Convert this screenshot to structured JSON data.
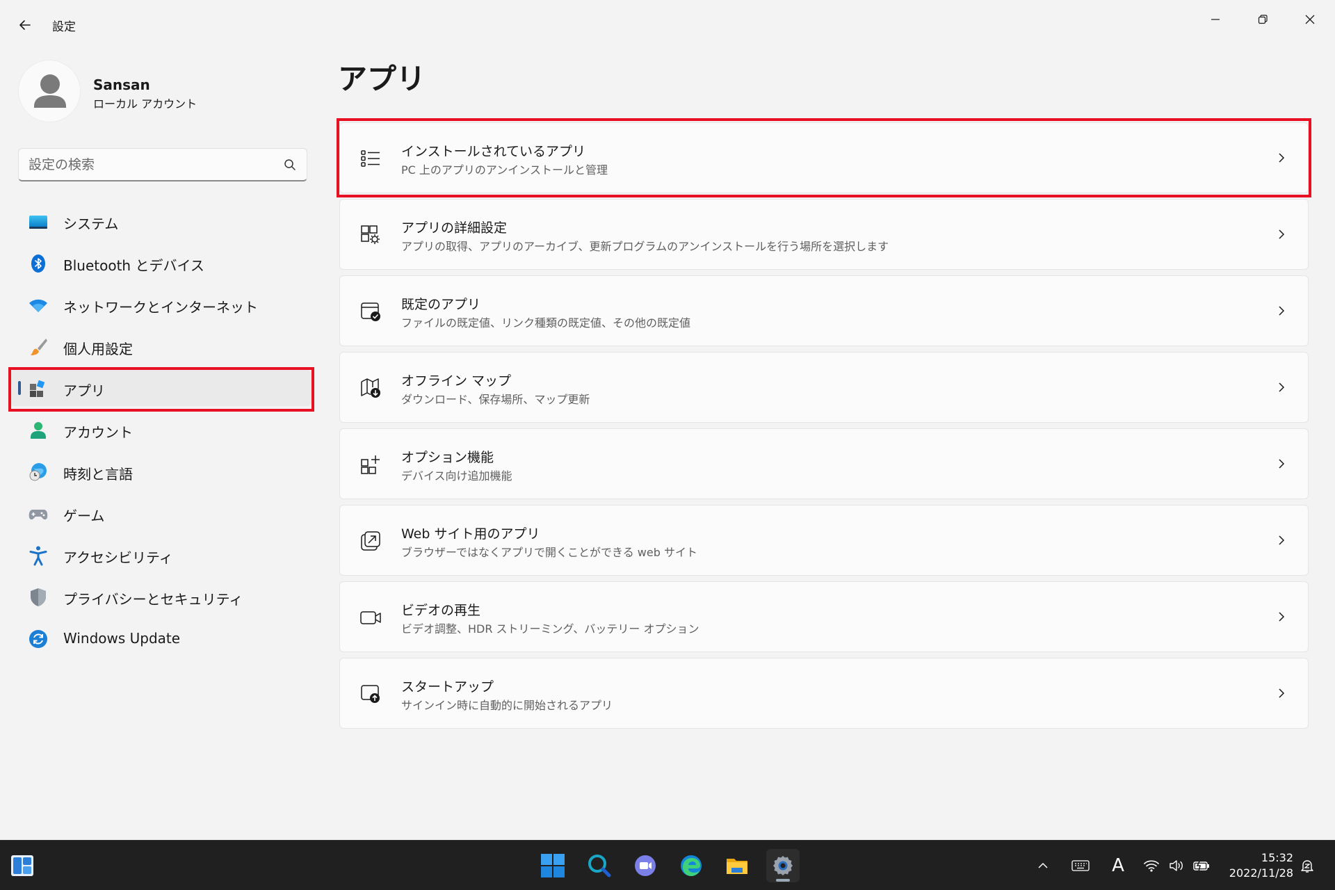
{
  "window": {
    "title": "設定",
    "controls": {
      "minimize": "minimize-icon",
      "maximize": "restore-icon",
      "close": "close-icon"
    }
  },
  "profile": {
    "name": "Sansan",
    "account_type": "ローカル アカウント"
  },
  "search": {
    "placeholder": "設定の検索",
    "value": ""
  },
  "sidebar": {
    "items": [
      {
        "label": "システム",
        "icon": "system-icon"
      },
      {
        "label": "Bluetooth とデバイス",
        "icon": "bluetooth-icon"
      },
      {
        "label": "ネットワークとインターネット",
        "icon": "wifi-icon"
      },
      {
        "label": "個人用設定",
        "icon": "brush-icon"
      },
      {
        "label": "アプリ",
        "icon": "apps-icon",
        "selected": true
      },
      {
        "label": "アカウント",
        "icon": "account-icon"
      },
      {
        "label": "時刻と言語",
        "icon": "time-language-icon"
      },
      {
        "label": "ゲーム",
        "icon": "gamepad-icon"
      },
      {
        "label": "アクセシビリティ",
        "icon": "accessibility-icon"
      },
      {
        "label": "プライバシーとセキュリティ",
        "icon": "shield-icon"
      },
      {
        "label": "Windows Update",
        "icon": "update-icon"
      }
    ]
  },
  "main": {
    "title": "アプリ",
    "cards": [
      {
        "title": "インストールされているアプリ",
        "desc": "PC 上のアプリのアンインストールと管理",
        "icon": "list-icon"
      },
      {
        "title": "アプリの詳細設定",
        "desc": "アプリの取得、アプリのアーカイブ、更新プログラムのアンインストールを行う場所を選択します",
        "icon": "app-settings-icon"
      },
      {
        "title": "既定のアプリ",
        "desc": "ファイルの既定値、リンク種類の既定値、その他の既定値",
        "icon": "default-apps-icon"
      },
      {
        "title": "オフライン マップ",
        "desc": "ダウンロード、保存場所、マップ更新",
        "icon": "map-download-icon"
      },
      {
        "title": "オプション機能",
        "desc": "デバイス向け追加機能",
        "icon": "add-feature-icon"
      },
      {
        "title": "Web サイト用のアプリ",
        "desc": "ブラウザーではなくアプリで開くことができる web サイト",
        "icon": "open-external-icon"
      },
      {
        "title": "ビデオの再生",
        "desc": "ビデオ調整、HDR ストリーミング、バッテリー オプション",
        "icon": "video-icon"
      },
      {
        "title": "スタートアップ",
        "desc": "サインイン時に自動的に開始されるアプリ",
        "icon": "startup-icon"
      }
    ]
  },
  "taskbar": {
    "apps": [
      "start-icon",
      "search-icon",
      "chat-icon",
      "edge-icon",
      "file-explorer-icon",
      "settings-icon"
    ],
    "tray": [
      "chevron-up-icon",
      "keyboard-icon",
      "ime-icon",
      "wifi-icon",
      "volume-icon",
      "battery-icon"
    ],
    "ime_label": "A",
    "time": "15:32",
    "date": "2022/11/28"
  },
  "colors": {
    "accent": "#0067c0",
    "highlight_box": "#e81123",
    "selected_indicator": "#2f5a8f",
    "taskbar_bg": "#202020"
  }
}
